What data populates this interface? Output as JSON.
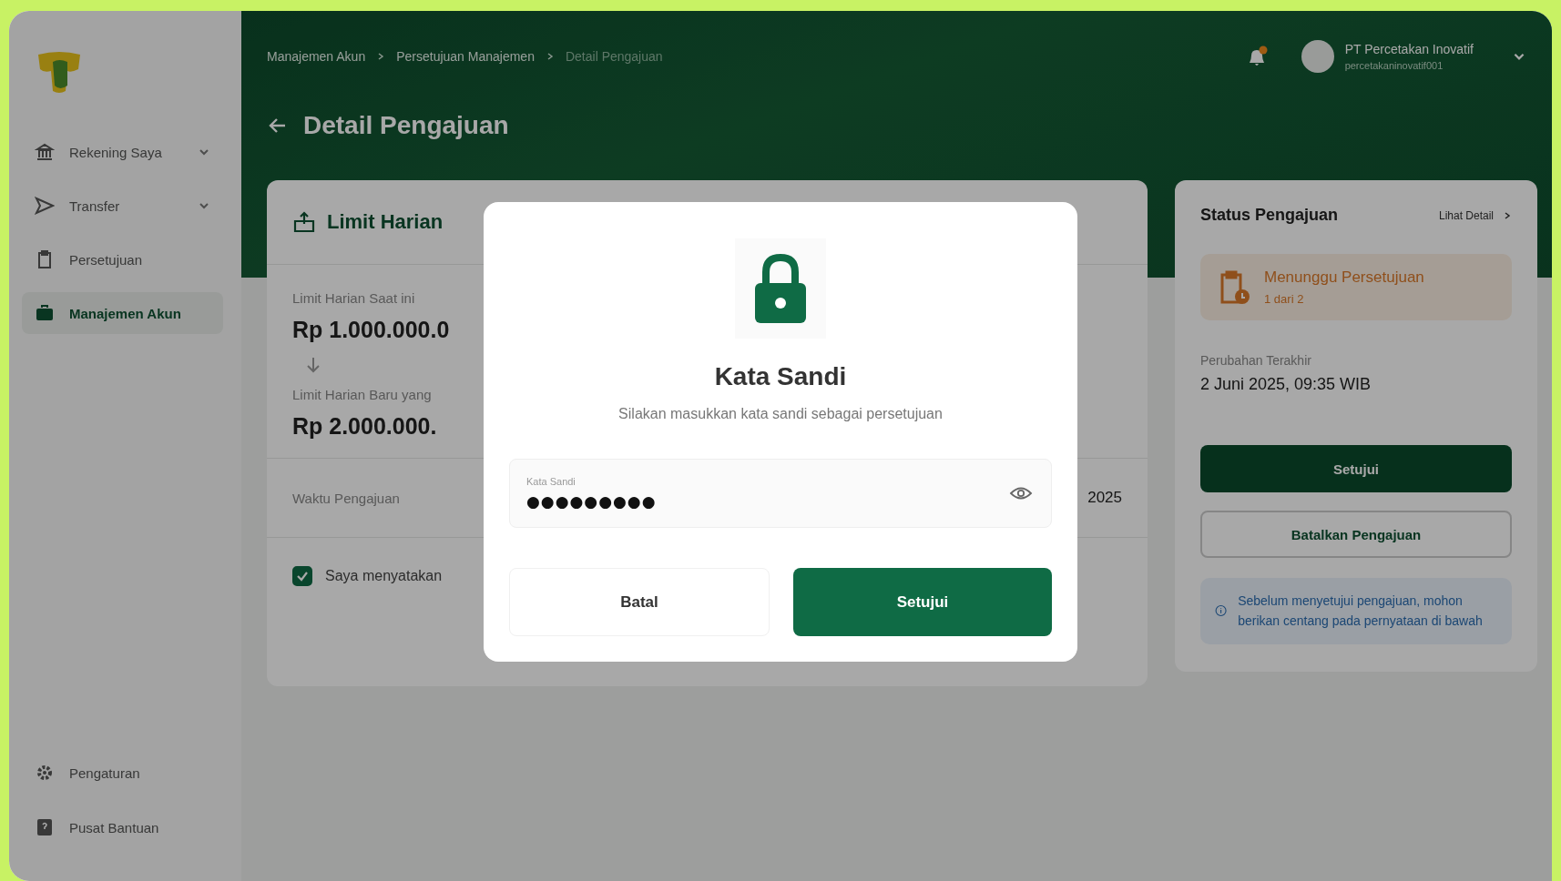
{
  "sidebar": {
    "items": [
      {
        "label": "Rekening Saya",
        "expandable": true,
        "selected": false
      },
      {
        "label": "Transfer",
        "expandable": true,
        "selected": false
      },
      {
        "label": "Persetujuan",
        "expandable": false,
        "selected": false
      },
      {
        "label": "Manajemen Akun",
        "expandable": false,
        "selected": true
      }
    ],
    "footer_items": [
      {
        "label": "Pengaturan"
      },
      {
        "label": "Pusat Bantuan"
      }
    ]
  },
  "topbar": {
    "breadcrumbs": [
      "Manajemen Akun",
      "Persetujuan Manajemen",
      "Detail Pengajuan"
    ],
    "has_unread": true,
    "account": {
      "name": "PT Percetakan Inovatif",
      "username": "percetakaninovatif001"
    }
  },
  "page": {
    "title": "Detail Pengajuan"
  },
  "limit_card": {
    "title": "Limit Harian",
    "current_label": "Limit Harian Saat ini",
    "current_value": "Rp 1.000.000.0",
    "new_label": "Limit Harian Baru yang",
    "new_value": "Rp 2.000.000.",
    "time_label": "Waktu Pengajuan",
    "time_value": "2025",
    "agreement": {
      "label": "Saya menyatakan",
      "checked": true
    }
  },
  "status_panel": {
    "title": "Status Pengajuan",
    "link": "Lihat Detail",
    "status": {
      "label": "Menunggu Persetujuan",
      "progress": "1 dari 2"
    },
    "updated_label": "Perubahan Terakhir",
    "updated_value": "2 Juni 2025, 09:35 WIB",
    "buttons": [
      {
        "label": "Setujui",
        "kind": "primary"
      },
      {
        "label": "Batalkan Pengajuan",
        "kind": "outline"
      }
    ],
    "info": "Sebelum menyetujui pengajuan, mohon berikan centang pada pernyataan di bawah"
  },
  "modal": {
    "title": "Kata Sandi",
    "subtitle": "Silakan masukkan kata sandi sebagai persetujuan",
    "field": {
      "label": "Kata Sandi",
      "value": "●●●●●●●●●"
    },
    "buttons": [
      {
        "label": "Batal",
        "kind": "secondary"
      },
      {
        "label": "Setujui",
        "kind": "primary"
      }
    ]
  }
}
